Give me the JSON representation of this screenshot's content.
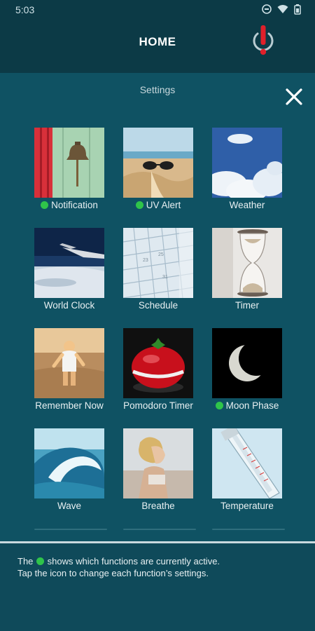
{
  "status_bar": {
    "time": "5:03",
    "icons": [
      "do-not-disturb-icon",
      "wifi-icon",
      "battery-icon"
    ]
  },
  "header": {
    "title": "HOME",
    "alert_icon": "power-alert-icon"
  },
  "settings": {
    "title": "Settings",
    "close_icon": "close-icon",
    "tiles": [
      {
        "label": "Notification",
        "active": true
      },
      {
        "label": "UV Alert",
        "active": true
      },
      {
        "label": "Weather",
        "active": false
      },
      {
        "label": "World Clock",
        "active": false
      },
      {
        "label": "Schedule",
        "active": false
      },
      {
        "label": "Timer",
        "active": false
      },
      {
        "label": "Remember Now",
        "active": false
      },
      {
        "label": "Pomodoro Timer",
        "active": false
      },
      {
        "label": "Moon Phase",
        "active": true
      },
      {
        "label": "Wave",
        "active": false
      },
      {
        "label": "Breathe",
        "active": false
      },
      {
        "label": "Temperature",
        "active": false
      }
    ]
  },
  "footer": {
    "line1_prefix": "The",
    "line1_suffix": "shows which functions are currently active.",
    "line2": "Tap the icon to change each function’s settings."
  },
  "colors": {
    "active_dot": "#2fc44a",
    "alert": "#e0202a",
    "background": "#0f4a5a"
  }
}
